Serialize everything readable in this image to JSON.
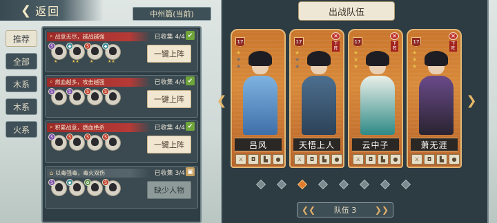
{
  "header": {
    "back_label": "返回",
    "chapter": "中州篇(当前)"
  },
  "tabs": [
    {
      "label": "推荐",
      "active": true
    },
    {
      "label": "全部",
      "active": false
    },
    {
      "label": "木系",
      "active": false
    },
    {
      "label": "木系",
      "active": false
    },
    {
      "label": "火系",
      "active": false
    }
  ],
  "groups": [
    {
      "title": "战意无尽，越战越强",
      "count": "已收集 4/4",
      "button": "一键上阵",
      "complete": true
    },
    {
      "title": "燃血越多，攻击越强",
      "count": "已收集 4/4",
      "button": "一键上阵",
      "complete": true
    },
    {
      "title": "积累战意，燃血绝杀",
      "count": "已收集 4/4",
      "button": "一键上阵",
      "complete": true
    },
    {
      "title": "以毒强毒，毒火双伤",
      "count": "已收集 3/4",
      "button": "缺少人物",
      "complete": false
    }
  ],
  "lineup": {
    "title": "出战队伍",
    "remove_label": "下阵",
    "cards": [
      {
        "name": "吕风",
        "level": "17",
        "stars": 1,
        "removable": false
      },
      {
        "name": "天悟上人",
        "level": "17",
        "stars": 1,
        "removable": true
      },
      {
        "name": "云中子",
        "level": "17",
        "stars": 3,
        "removable": true
      },
      {
        "name": "萧无涯",
        "level": "17",
        "stars": 3,
        "removable": true
      }
    ],
    "team_label": "队伍 3",
    "pages": 8,
    "active_page": 3
  },
  "colors": {
    "accent": "#e07b2d",
    "card": "#d07f33",
    "panel": "#2f3d44",
    "remove": "#c0332c"
  }
}
